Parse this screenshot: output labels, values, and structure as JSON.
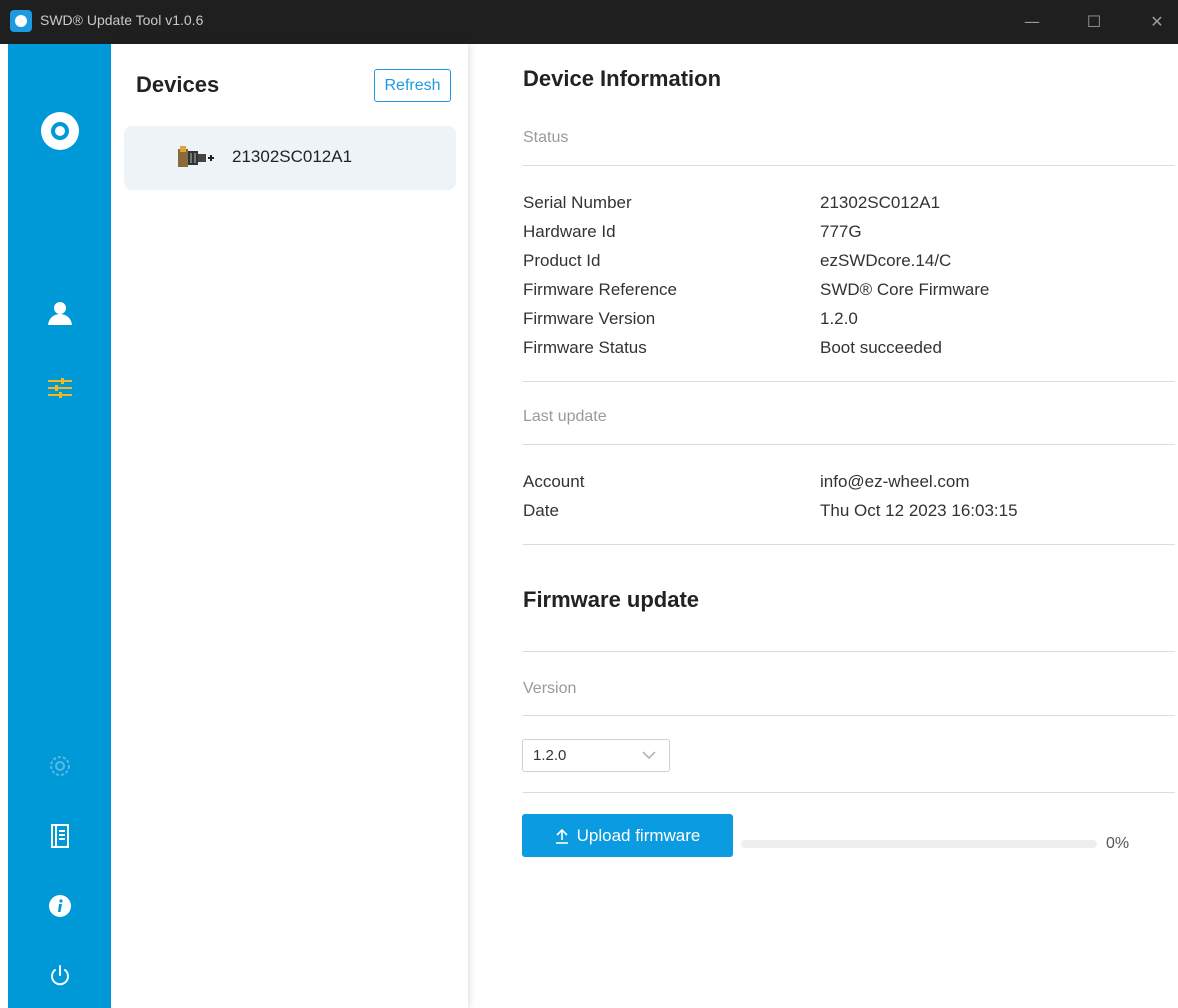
{
  "window": {
    "title": "SWD® Update Tool v1.0.6",
    "controls": {
      "minimize": "—",
      "maximize": "☐",
      "close": "✕"
    }
  },
  "sidebar": {
    "icons": [
      "logo-icon",
      "user-icon",
      "sliders-icon",
      "gear-icon",
      "manual-icon",
      "info-icon",
      "power-icon"
    ],
    "active_item": "sliders-icon",
    "colors": {
      "background": "#0099d8",
      "active": "#f5b81c",
      "icon": "#ffffff"
    }
  },
  "devices": {
    "title": "Devices",
    "refresh_label": "Refresh",
    "items": [
      {
        "label": "21302SC012A1"
      }
    ]
  },
  "device_info": {
    "title": "Device Information",
    "status_label": "Status",
    "rows": [
      {
        "label": "Serial Number",
        "value": "21302SC012A1"
      },
      {
        "label": "Hardware Id",
        "value": "777G"
      },
      {
        "label": "Product Id",
        "value": "ezSWDcore.14/C"
      },
      {
        "label": "Firmware Reference",
        "value": "SWD® Core Firmware"
      },
      {
        "label": "Firmware Version",
        "value": "1.2.0"
      },
      {
        "label": "Firmware Status",
        "value": "Boot succeeded"
      }
    ],
    "last_update_label": "Last update",
    "last_update_rows": [
      {
        "label": "Account",
        "value": "info@ez-wheel.com"
      },
      {
        "label": "Date",
        "value": "Thu Oct 12 2023 16:03:15"
      }
    ]
  },
  "firmware_update": {
    "title": "Firmware update",
    "version_label": "Version",
    "selected_version": "1.2.0",
    "upload_label": "Upload firmware",
    "progress_percent": 0,
    "progress_text": "0%"
  }
}
